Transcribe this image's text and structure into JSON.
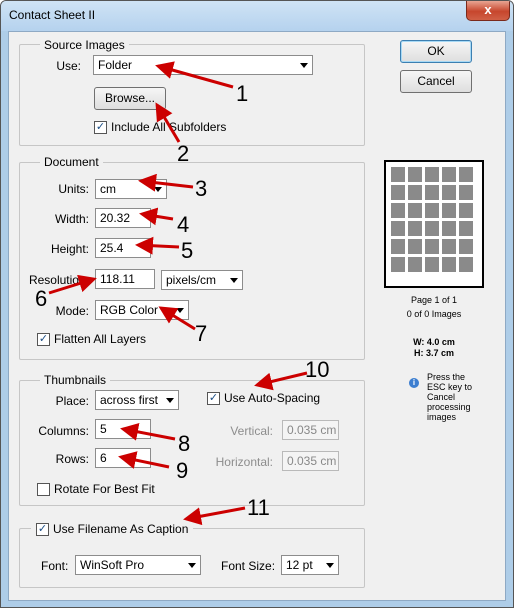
{
  "window": {
    "title": "Contact Sheet II",
    "close_glyph": "x"
  },
  "buttons": {
    "ok": "OK",
    "cancel": "Cancel",
    "browse": "Browse..."
  },
  "source_images": {
    "group_label": "Source Images",
    "use_label": "Use:",
    "use_value": "Folder",
    "include_subfolders_label": "Include All Subfolders",
    "include_subfolders_checked": true
  },
  "document": {
    "group_label": "Document",
    "units_label": "Units:",
    "units_value": "cm",
    "width_label": "Width:",
    "width_value": "20.32",
    "height_label": "Height:",
    "height_value": "25.4",
    "resolution_label": "Resolution:",
    "resolution_value": "118.11",
    "resolution_units": "pixels/cm",
    "mode_label": "Mode:",
    "mode_value": "RGB Color",
    "flatten_label": "Flatten All Layers",
    "flatten_checked": true
  },
  "thumbnails": {
    "group_label": "Thumbnails",
    "place_label": "Place:",
    "place_value": "across first",
    "auto_spacing_label": "Use Auto-Spacing",
    "auto_spacing_checked": true,
    "columns_label": "Columns:",
    "columns_value": "5",
    "rows_label": "Rows:",
    "rows_value": "6",
    "vertical_label": "Vertical:",
    "vertical_value": "0.035 cm",
    "horizontal_label": "Horizontal:",
    "horizontal_value": "0.035 cm",
    "rotate_label": "Rotate For Best Fit",
    "rotate_checked": false
  },
  "caption": {
    "use_filename_label": "Use Filename As Caption",
    "use_filename_checked": true,
    "font_label": "Font:",
    "font_value": "WinSoft Pro",
    "font_size_label": "Font Size:",
    "font_size_value": "12 pt"
  },
  "preview": {
    "grid_columns": 5,
    "grid_rows": 6,
    "page_info": "Page 1 of 1",
    "images_info": "0 of 0 Images",
    "width_info": "W: 4.0 cm",
    "height_info": "H: 3.7 cm",
    "tip_lines": [
      "Press the",
      "ESC key to",
      "Cancel",
      "processing",
      "images"
    ]
  },
  "annotations": [
    "1",
    "2",
    "3",
    "4",
    "5",
    "6",
    "7",
    "8",
    "9",
    "10",
    "11"
  ],
  "colors": {
    "arrow": "#cc0000",
    "title_bar": "#b5d2ee",
    "dialog_bg": "#f0f0f0"
  }
}
